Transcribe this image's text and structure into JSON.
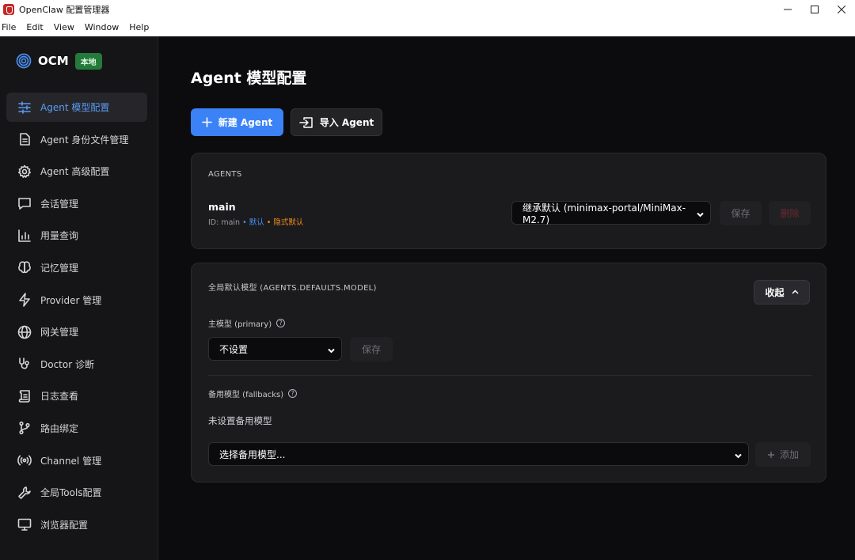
{
  "window": {
    "title": "OpenClaw 配置管理器",
    "controls": [
      "minimize",
      "maximize",
      "close"
    ]
  },
  "menu": [
    "File",
    "Edit",
    "View",
    "Window",
    "Help"
  ],
  "sidebar": {
    "brand": "OCM",
    "badge": "本地",
    "items": [
      {
        "label": "Agent 模型配置",
        "icon": "sliders-icon",
        "active": true
      },
      {
        "label": "Agent 身份文件管理",
        "icon": "file-icon",
        "active": false
      },
      {
        "label": "Agent 高级配置",
        "icon": "gear-icon",
        "active": false
      },
      {
        "label": "会话管理",
        "icon": "chat-icon",
        "active": false
      },
      {
        "label": "用量查询",
        "icon": "bar-chart-icon",
        "active": false
      },
      {
        "label": "记忆管理",
        "icon": "brain-icon",
        "active": false
      },
      {
        "label": "Provider 管理",
        "icon": "lightning-icon",
        "active": false
      },
      {
        "label": "网关管理",
        "icon": "globe-icon",
        "active": false
      },
      {
        "label": "Doctor 诊断",
        "icon": "stethoscope-icon",
        "active": false
      },
      {
        "label": "日志查看",
        "icon": "scroll-icon",
        "active": false
      },
      {
        "label": "路由绑定",
        "icon": "git-branch-icon",
        "active": false
      },
      {
        "label": "Channel 管理",
        "icon": "broadcast-icon",
        "active": false
      },
      {
        "label": "全局Tools配置",
        "icon": "wrench-icon",
        "active": false
      },
      {
        "label": "浏览器配置",
        "icon": "monitor-icon",
        "active": false
      }
    ]
  },
  "main": {
    "title": "Agent 模型配置",
    "new_agent_label": "新建 Agent",
    "import_agent_label": "导入 Agent",
    "agents_card": {
      "title": "AGENTS",
      "agent": {
        "name": "main",
        "id_text": "ID: main",
        "separator": " • ",
        "default_tag": "默认",
        "implicit_tag": "隐式默认",
        "model_select_value": "继承默认 (minimax-portal/MiniMax-M2.7)",
        "save_label": "保存",
        "delete_label": "删除"
      }
    },
    "defaults_card": {
      "title": "全局默认模型 (AGENTS.DEFAULTS.MODEL)",
      "collapse_label": "收起",
      "primary_label": "主模型 (primary)",
      "primary_select_value": "不设置",
      "primary_save_label": "保存",
      "fallbacks_label": "备用模型 (fallbacks)",
      "fallbacks_empty": "未设置备用模型",
      "fallback_select_value": "选择备用模型...",
      "add_label": "添加"
    }
  },
  "colors": {
    "accent": "#3b82f6",
    "active_nav_text": "#5a9bf5",
    "badge_bg": "#237a3b",
    "implicit_default": "#f08c1a"
  }
}
